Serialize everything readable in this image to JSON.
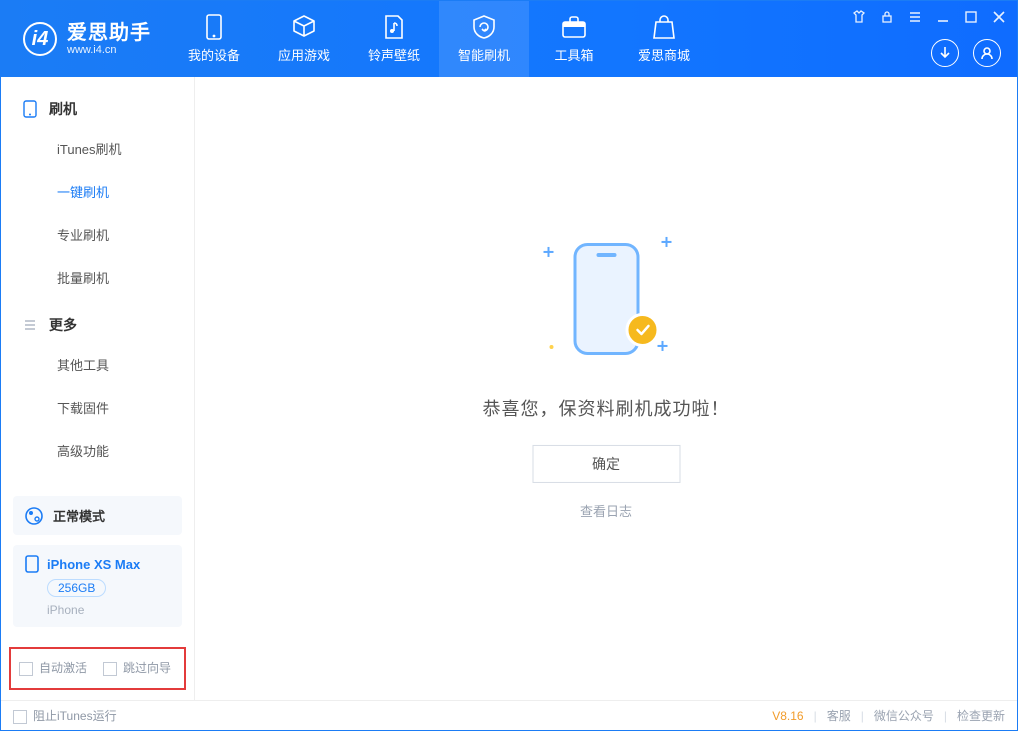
{
  "header": {
    "logo_title": "爱思助手",
    "logo_subtitle": "www.i4.cn",
    "nav": [
      {
        "label": "我的设备"
      },
      {
        "label": "应用游戏"
      },
      {
        "label": "铃声壁纸"
      },
      {
        "label": "智能刷机"
      },
      {
        "label": "工具箱"
      },
      {
        "label": "爱思商城"
      }
    ]
  },
  "sidebar": {
    "groups": [
      {
        "title": "刷机",
        "items": [
          {
            "label": "iTunes刷机"
          },
          {
            "label": "一键刷机"
          },
          {
            "label": "专业刷机"
          },
          {
            "label": "批量刷机"
          }
        ]
      },
      {
        "title": "更多",
        "items": [
          {
            "label": "其他工具"
          },
          {
            "label": "下载固件"
          },
          {
            "label": "高级功能"
          }
        ]
      }
    ],
    "mode_label": "正常模式",
    "device": {
      "name": "iPhone XS Max",
      "capacity": "256GB",
      "type": "iPhone"
    },
    "bottom": {
      "auto_activate": "自动激活",
      "skip_guide": "跳过向导"
    }
  },
  "main": {
    "success_text": "恭喜您，保资料刷机成功啦！",
    "ok_button": "确定",
    "view_log": "查看日志"
  },
  "status": {
    "block_itunes": "阻止iTunes运行",
    "version": "V8.16",
    "kefu": "客服",
    "wechat": "微信公众号",
    "update": "检查更新"
  }
}
